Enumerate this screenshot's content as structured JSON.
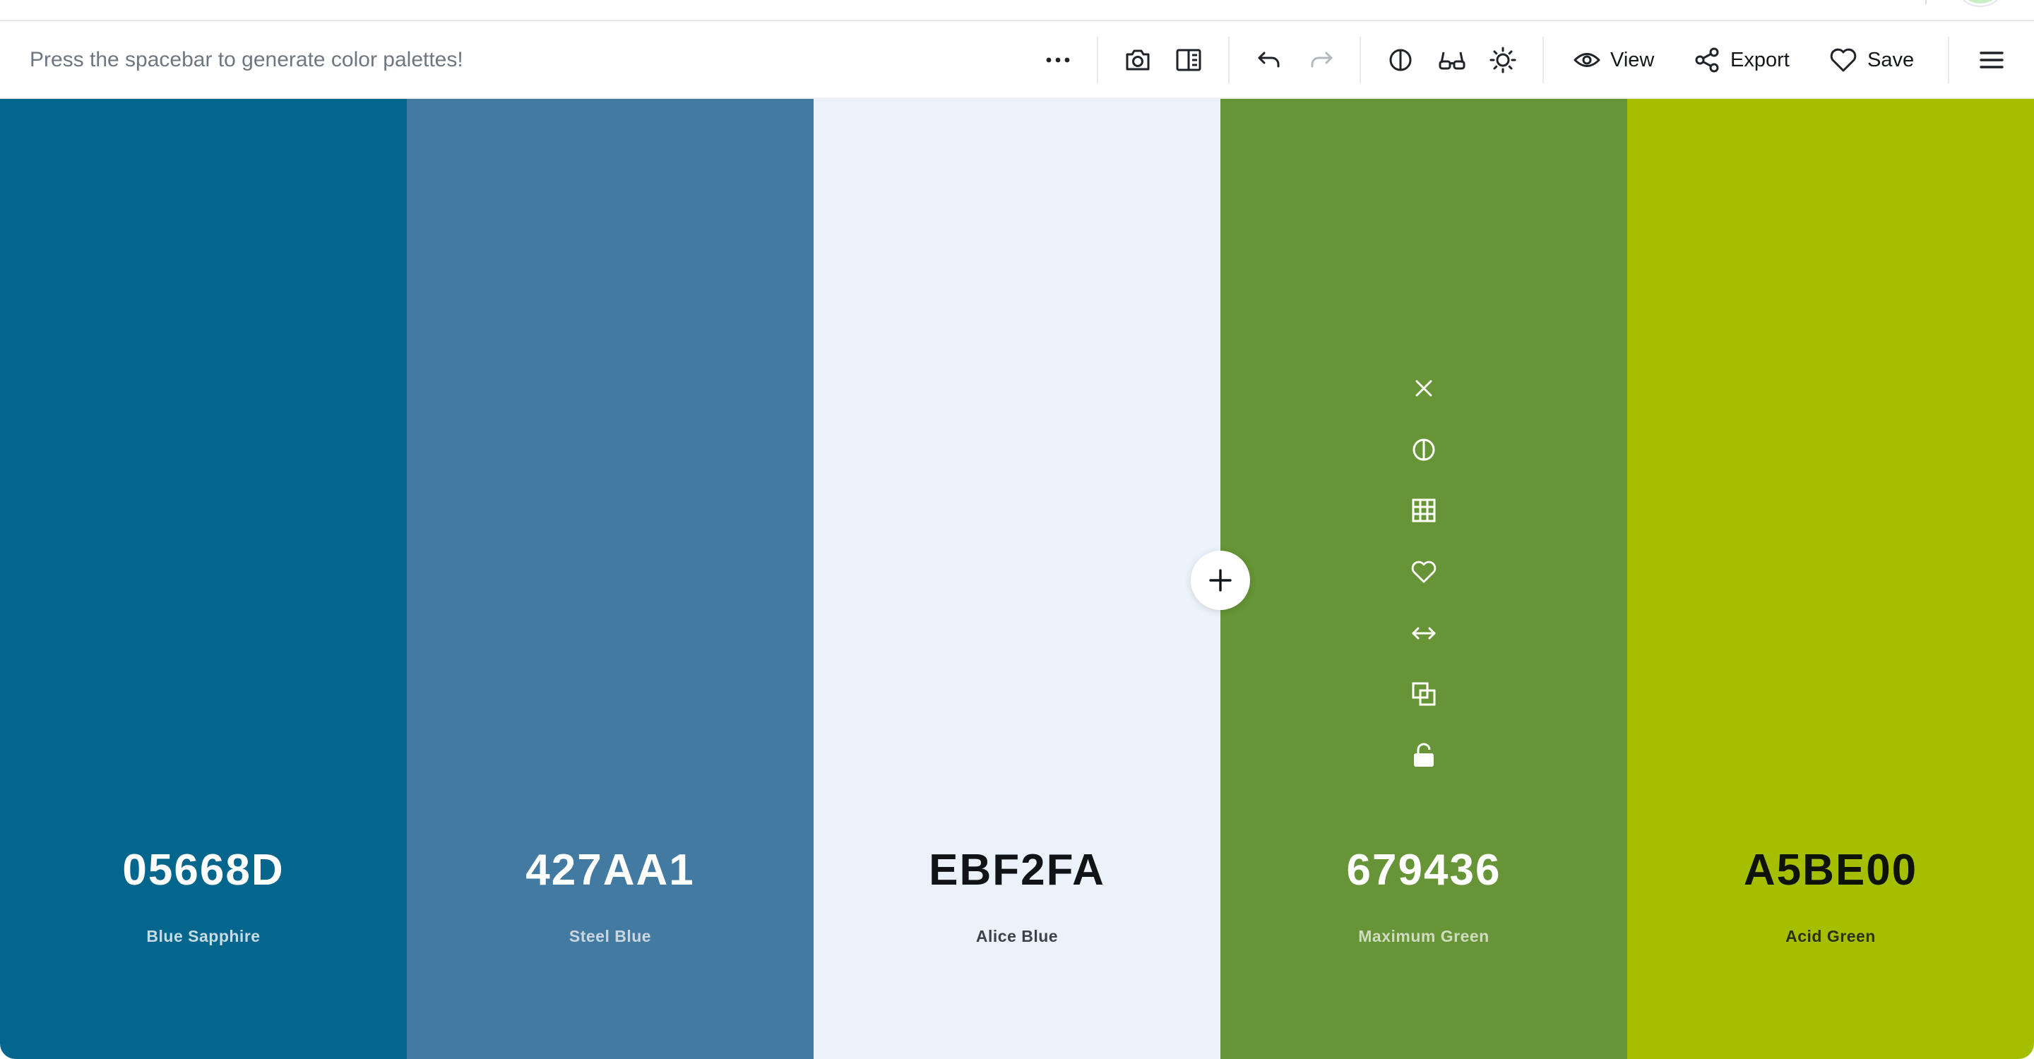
{
  "toolbar": {
    "hint": "Press the spacebar to generate color palettes!",
    "view_label": "View",
    "export_label": "Export",
    "save_label": "Save"
  },
  "palette": [
    {
      "hex": "05668D",
      "name": "Blue Sapphire",
      "bg": "#05668D",
      "text": "#ffffff",
      "subtext": "#c7dbe4"
    },
    {
      "hex": "427AA1",
      "name": "Steel Blue",
      "bg": "#427AA1",
      "text": "#ffffff",
      "subtext": "#cad7e2"
    },
    {
      "hex": "EBF2FA",
      "name": "Alice Blue",
      "bg": "#EBF2FA",
      "text": "#111417",
      "subtext": "#3d4248"
    },
    {
      "hex": "679436",
      "name": "Maximum Green",
      "bg": "#679436",
      "text": "#ffffff",
      "subtext": "#cfdcbf"
    },
    {
      "hex": "A5BE00",
      "name": "Acid Green",
      "bg": "#A5BE00",
      "text": "#0f1208",
      "subtext": "#2a3106"
    }
  ],
  "swatch_tools": [
    "close-icon",
    "contrast-icon",
    "shades-grid-icon",
    "heart-icon",
    "drag-arrows-icon",
    "copy-icon",
    "unlock-icon"
  ]
}
